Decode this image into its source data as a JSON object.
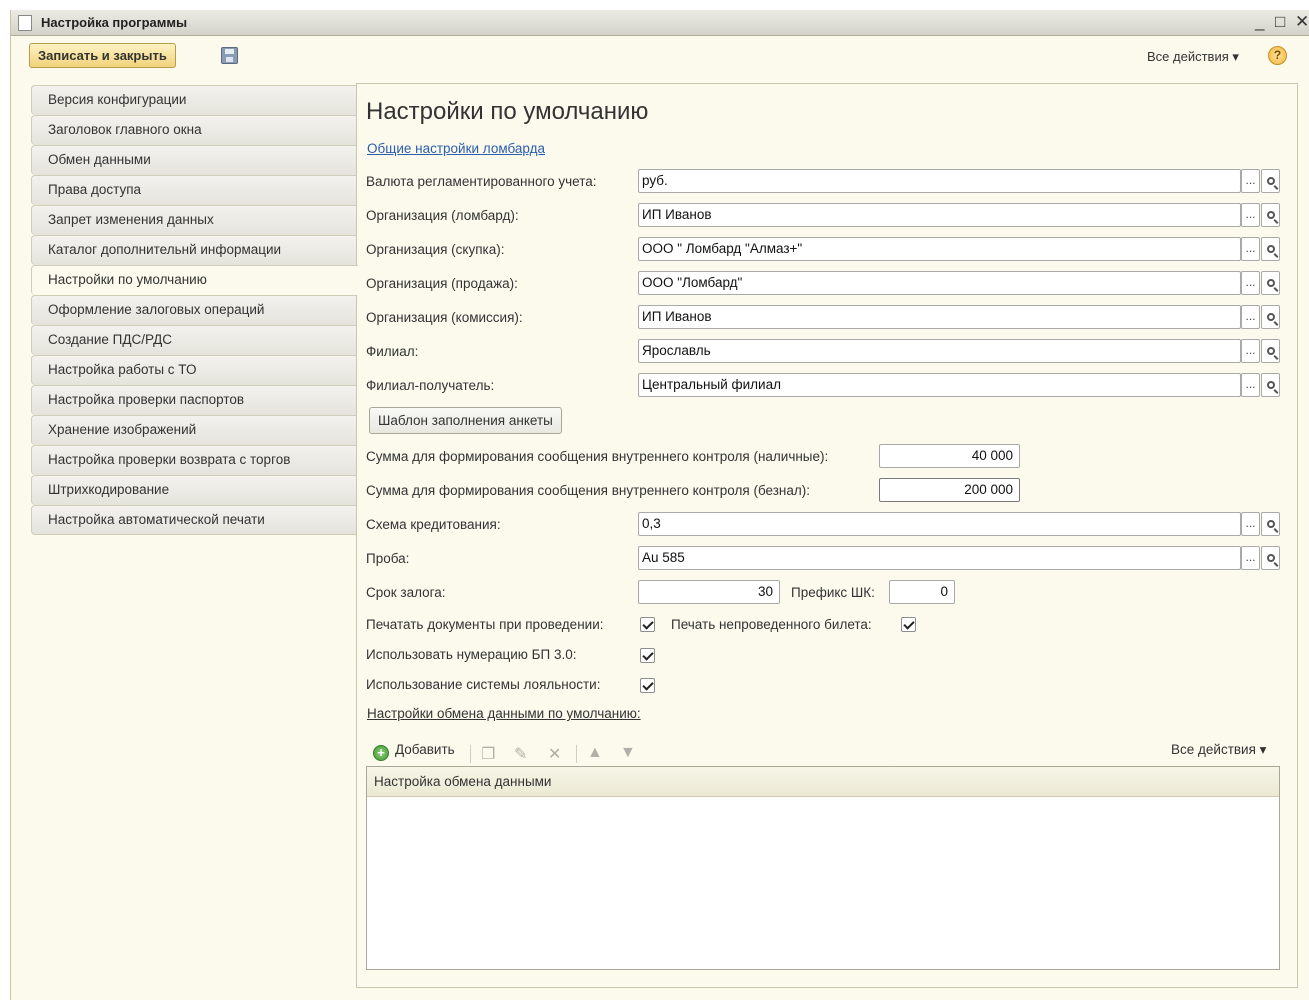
{
  "window": {
    "title": "Настройка программы",
    "controls": {
      "minimize": "_",
      "maximize": "□",
      "close": "✕"
    }
  },
  "command_bar": {
    "save_close_label": "Записать и закрыть",
    "all_actions_label": "Все действия ▾",
    "help_label": "?"
  },
  "sidebar": {
    "items": [
      {
        "label": "Версия конфигурации"
      },
      {
        "label": "Заголовок главного окна"
      },
      {
        "label": "Обмен данными"
      },
      {
        "label": "Права доступа"
      },
      {
        "label": "Запрет изменения данных"
      },
      {
        "label": "Каталог дополнительнй информации"
      },
      {
        "label": "Настройки по умолчанию",
        "active": true
      },
      {
        "label": "Оформление залоговых операций"
      },
      {
        "label": "Создание ПДС/РДС"
      },
      {
        "label": "Настройка работы с ТО"
      },
      {
        "label": "Настройка проверки паспортов"
      },
      {
        "label": "Хранение изображений"
      },
      {
        "label": "Настройка проверки возврата с торгов"
      },
      {
        "label": "Штрихкодирование"
      },
      {
        "label": "Настройка автоматической печати"
      }
    ]
  },
  "main": {
    "title": "Настройки по умолчанию",
    "general_link": "Общие настройки ломбарда",
    "fields": [
      {
        "label": "Валюта регламентированного учета:",
        "value": "руб."
      },
      {
        "label": "Организация (ломбард):",
        "value": "ИП Иванов"
      },
      {
        "label": "Организация (скупка):",
        "value": "ООО \" Ломбард \"Алмаз+\""
      },
      {
        "label": "Организация (продажа):",
        "value": "ООО \"Ломбард\""
      },
      {
        "label": "Организация (комиссия):",
        "value": "ИП Иванов"
      },
      {
        "label": "Филиал:",
        "value": "Ярославль"
      },
      {
        "label": "Филиал-получатель:",
        "value": "Центральный филиал"
      }
    ],
    "template_button": "Шаблон заполнения анкеты",
    "sum_cash": {
      "label": "Сумма для формирования сообщения внутреннего контроля (наличные):",
      "value": "40 000"
    },
    "sum_noncash": {
      "label": "Сумма для формирования сообщения внутреннего контроля (безнал):",
      "value": "200 000"
    },
    "credit_scheme": {
      "label": "Схема кредитования:",
      "value": "0,3"
    },
    "probe": {
      "label": "Проба:",
      "value": "Au 585"
    },
    "pledge_term": {
      "label": "Срок залога:",
      "value": "30"
    },
    "barcode_prefix": {
      "label": "Префикс ШК:",
      "value": "0"
    },
    "print_docs": {
      "label": "Печатать документы при проведении:",
      "checked": true
    },
    "print_unposted": {
      "label": "Печать непроведенного билета:",
      "checked": true
    },
    "use_bp30": {
      "label": "Использовать нумерацию БП 3.0:",
      "checked": true
    },
    "use_loyalty": {
      "label": "Использование системы лояльности:",
      "checked": true
    },
    "exchange_section_label": "Настройки обмена данными по умолчанию:",
    "toolbar": {
      "add_label": "Добавить",
      "all_actions_label": "Все действия ▾"
    },
    "grid": {
      "columns": [
        "Настройка обмена данными"
      ],
      "rows": []
    }
  },
  "icons": {
    "add": "plus-circle-icon",
    "copy": "copy-icon",
    "edit": "pencil-icon",
    "delete": "delete-icon",
    "move_up": "arrow-up-icon",
    "move_down": "arrow-down-icon",
    "save": "floppy-disk-icon",
    "help": "help-icon",
    "select": "ellipsis-icon",
    "open": "search-icon"
  }
}
